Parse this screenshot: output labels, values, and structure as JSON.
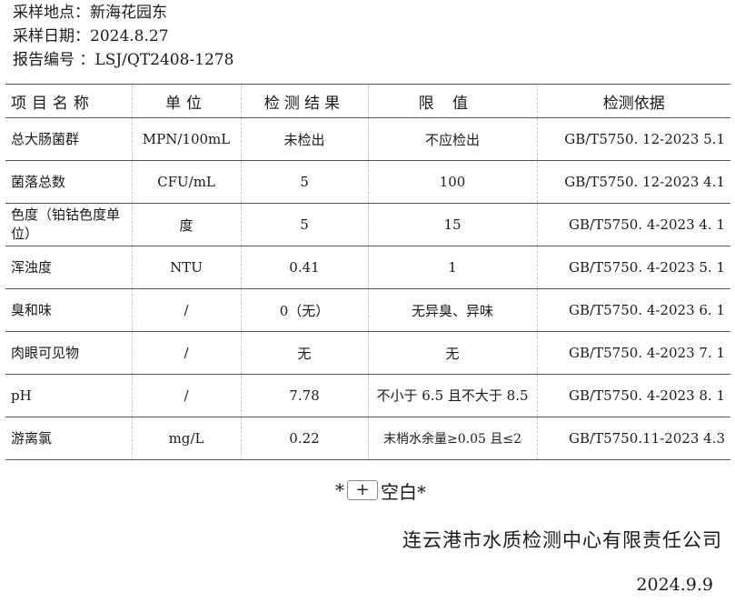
{
  "header": {
    "location_label": "采样地点：",
    "location_value": "新海花园东",
    "date_label": "采样日期：",
    "date_value": "2024.8.27",
    "report_label": "报告编号 ：",
    "report_value": "LSJ/QT2408-1278"
  },
  "table": {
    "columns": [
      "项目名称",
      "单位",
      "检测结果",
      "限值",
      "检测依据"
    ],
    "rows": [
      [
        "总大肠菌群",
        "MPN/100mL",
        "未检出",
        "不应检出",
        "GB/T5750. 12-2023    5.1"
      ],
      [
        "菌落总数",
        "CFU/mL",
        "5",
        "100",
        "GB/T5750. 12-2023    4.1"
      ],
      [
        "色度（铂钴色度单位）",
        "度",
        "5",
        "15",
        "GB/T5750. 4-2023    4. 1"
      ],
      [
        "浑浊度",
        "NTU",
        "0.41",
        "1",
        "GB/T5750. 4-2023    5. 1"
      ],
      [
        "臭和味",
        "/",
        "0（无）",
        "无异臭、异味",
        "GB/T5750. 4-2023    6. 1"
      ],
      [
        "肉眼可见物",
        "/",
        "无",
        "无",
        "GB/T5750. 4-2023    7. 1"
      ],
      [
        "pH",
        "/",
        "7.78",
        "不小于 6.5 且不大于 8.5",
        "GB/T5750. 4-2023    8. 1"
      ],
      [
        "游离氯",
        "mg/L",
        "0.22",
        "末梢水余量≥0.05 且≤2",
        "GB/T5750.11-2023    4.3"
      ]
    ]
  },
  "blank": {
    "left_mark": "*",
    "plus_symbol": "+",
    "text": "空白*"
  },
  "footer": {
    "company": "连云港市水质检测中心有限责任公司",
    "date": "2024.9.9"
  }
}
